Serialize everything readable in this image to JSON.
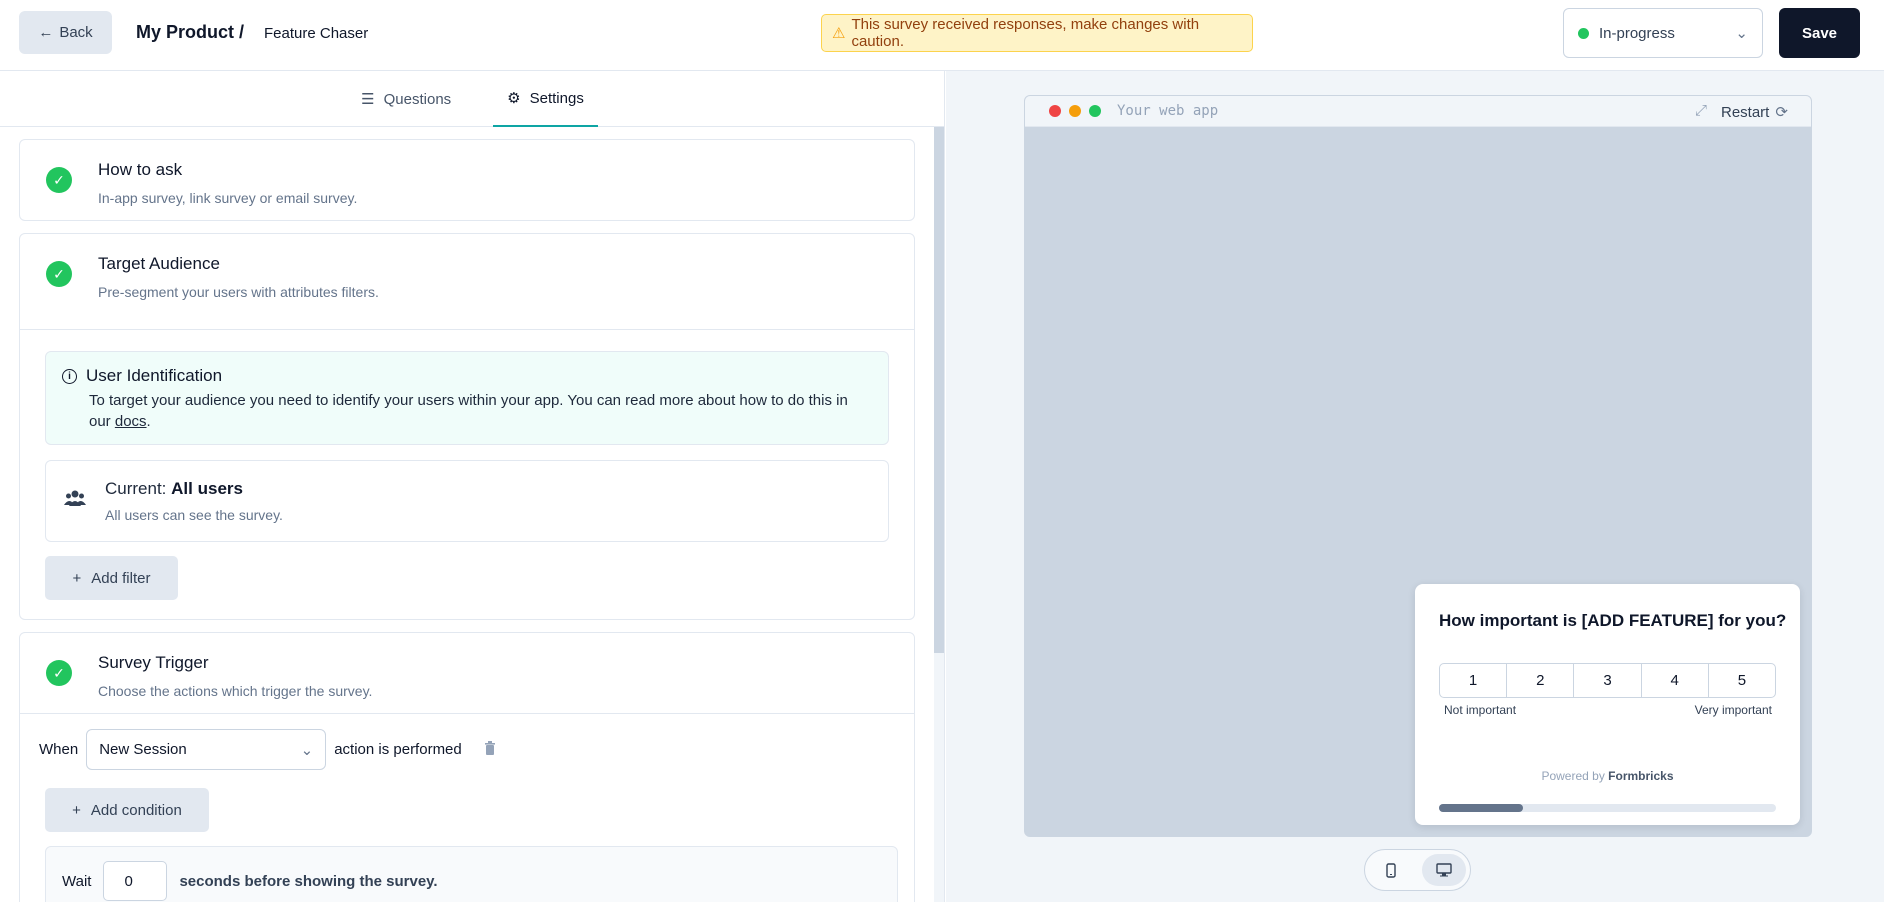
{
  "header": {
    "back_label": "Back",
    "product_name": "My Product /",
    "survey_name": "Feature Chaser",
    "warning_text": "This survey received responses, make changes with caution.",
    "status_label": "In-progress",
    "status_color": "#22c55e",
    "save_label": "Save"
  },
  "tabs": [
    {
      "label": "Questions",
      "icon": "list-icon",
      "active": false
    },
    {
      "label": "Settings",
      "icon": "gear-icon",
      "active": true
    }
  ],
  "settings": {
    "how_to_ask": {
      "title": "How to ask",
      "subtitle": "In-app survey, link survey or email survey."
    },
    "target_audience": {
      "title": "Target Audience",
      "subtitle": "Pre-segment your users with attributes filters.",
      "user_identification": {
        "title": "User Identification",
        "body": "To target your audience you need to identify your users within your app. You can read more about how to do this in our",
        "link": "docs",
        "period": "."
      },
      "current_prefix": "Current:",
      "current_value": "All users",
      "current_sub": "All users can see the survey.",
      "add_filter_label": "Add filter"
    },
    "survey_trigger": {
      "title": "Survey Trigger",
      "subtitle": "Choose the actions which trigger the survey.",
      "when_label": "When",
      "action_value": "New Session",
      "action_suffix": "action is performed",
      "add_condition_label": "Add condition",
      "wait_prefix": "Wait",
      "wait_value": "0",
      "wait_suffix": "seconds before showing the survey."
    }
  },
  "preview": {
    "browser_title": "Your web app",
    "restart_label": "Restart",
    "question": "How important is [ADD FEATURE] for you?",
    "scale": [
      "1",
      "2",
      "3",
      "4",
      "5"
    ],
    "scale_low_label": "Not important",
    "scale_high_label": "Very important",
    "powered_prefix": "Powered by",
    "powered_brand": "Formbricks",
    "progress": 0.25,
    "device_modes": [
      "phone-icon",
      "desktop-icon"
    ],
    "active_device": "desktop-icon"
  }
}
